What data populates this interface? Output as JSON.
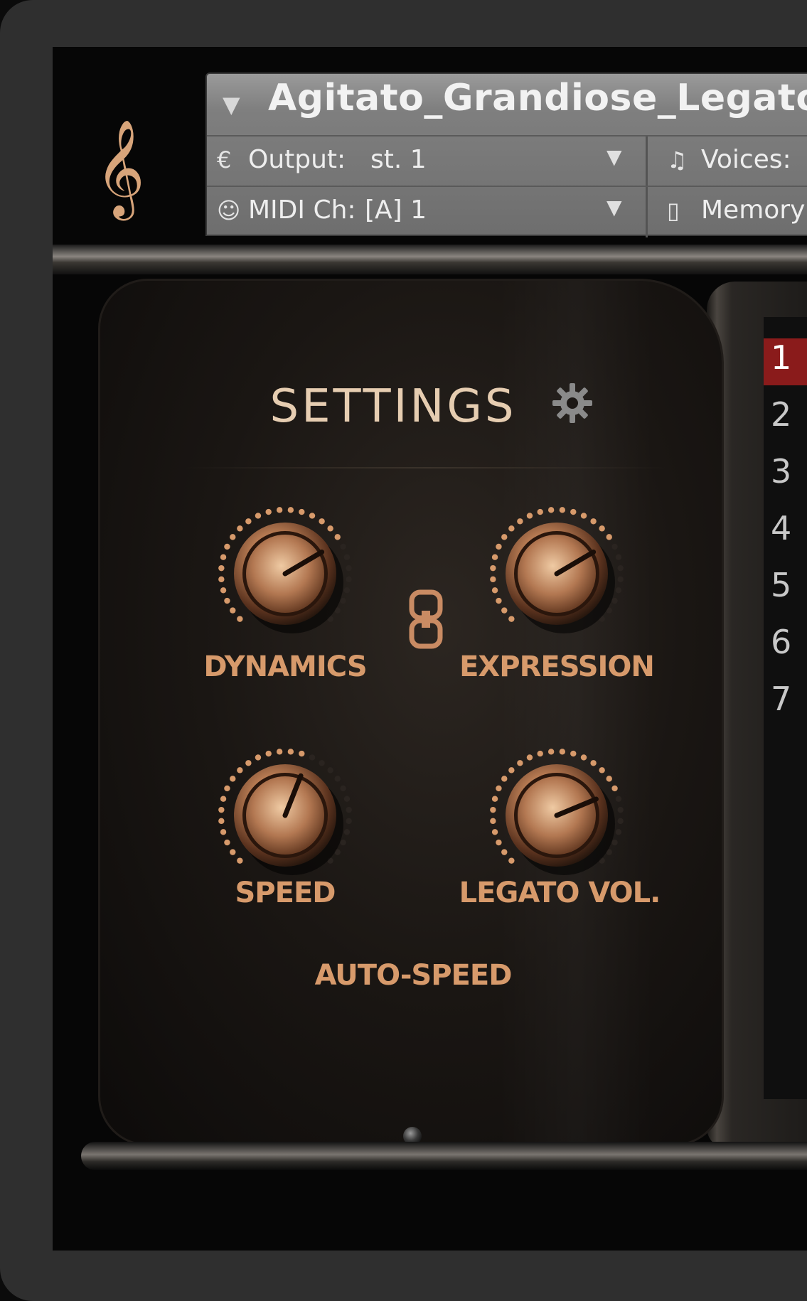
{
  "header": {
    "instrument_name": "Agitato_Grandiose_Legato_C",
    "output_label": "Output:",
    "output_value": "st. 1",
    "voices_label": "Voices:",
    "midi_label": "MIDI Ch:",
    "midi_value": "[A]  1",
    "memory_label": "Memory"
  },
  "settings": {
    "title": "SETTINGS",
    "knobs": [
      {
        "label": "DYNAMICS",
        "value": 0.72
      },
      {
        "label": "EXPRESSION",
        "value": 0.72
      },
      {
        "label": "SPEED",
        "value": 0.58
      },
      {
        "label": "LEGATO VOL.",
        "value": 0.75
      }
    ],
    "auto_speed_label": "AUTO-SPEED"
  },
  "slots": [
    "1",
    "2",
    "3",
    "4",
    "5",
    "6",
    "7"
  ],
  "colors": {
    "accent_copper": "#d79a6b",
    "title_cream": "#e6cdb1",
    "active_slot": "#8a1b1b"
  }
}
